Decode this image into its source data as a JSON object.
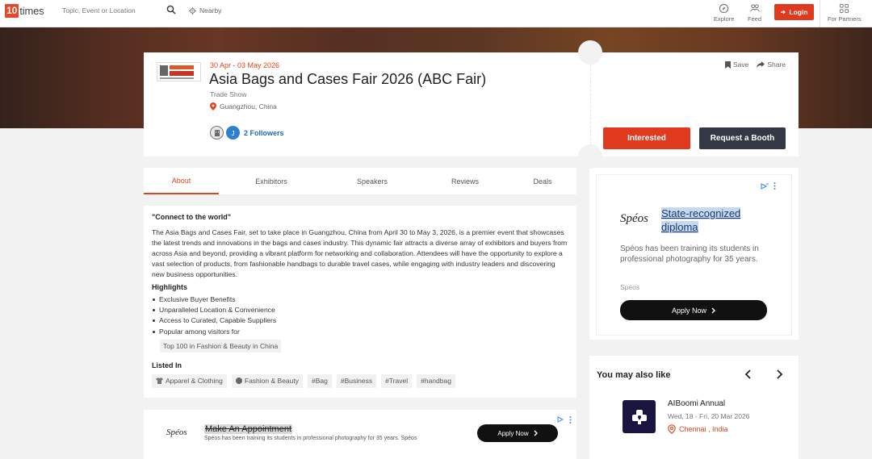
{
  "nav": {
    "logo_num": "10",
    "logo_text": "times",
    "search_placeholder": "Topic, Event or Location",
    "nearby": "Nearby",
    "explore": "Explore",
    "feed": "Feed",
    "login": "Login",
    "partners": "For Partners"
  },
  "event": {
    "date": "30 Apr - 03 May 2026",
    "title": "Asia Bags and Cases Fair 2026 (ABC Fair)",
    "type": "Trade Show",
    "location": "Guangzhou, China",
    "follower_avatar_2": "J",
    "followers": "2 Followers",
    "save": "Save",
    "share": "Share",
    "interested": "Interested",
    "request_booth": "Request a Booth"
  },
  "tabs": [
    "About",
    "Exhibitors",
    "Speakers",
    "Reviews",
    "Deals"
  ],
  "about": {
    "quote": "\"Connect to the world\"",
    "description": "The Asia Bags and Cases Fair, set to take place in Guangzhou, China from April 30 to May 3, 2026, is a premier event that showcases the latest trends and innovations in the bags and cases industry. This dynamic fair attracts a diverse array of exhibitors and buyers from across Asia and beyond, providing a vibrant platform for networking and collaboration. Attendees will have the opportunity to explore a vast selection of products, from fashionable handbags to durable travel cases, while engaging with industry leaders and discovering new business opportunities.",
    "highlights_heading": "Highlights",
    "highlights": [
      "Exclusive Buyer Benefits",
      "Unparalleled Location & Convenience",
      "Access to Curated, Capable Suppliers",
      "Popular among visitors for"
    ],
    "popular_tag": "Top 100 in Fashion & Beauty in China",
    "listed_heading": "Listed In",
    "listed_tags": [
      "Apparel & Clothing",
      "Fashion & Beauty",
      "#Bag",
      "#Business",
      "#Travel",
      "#handbag"
    ]
  },
  "bottom_ad": {
    "brand": "Spéos",
    "title": "Make An Appointment",
    "subtitle": "Spéos has been training its students in professional photography for 35 years. Spéos",
    "button": "Apply Now"
  },
  "right_ad": {
    "brand": "Spéos",
    "title": "State-recognized diploma",
    "description": "Spéos has been training its students in professional photography for 35 years.",
    "sponsor": "Spéos",
    "button": "Apply Now"
  },
  "also_like": {
    "heading": "You may also like",
    "event_name": "AIBoomi Annual",
    "event_dates": "Wed, 18 - Fri, 20 Mar 2026",
    "event_location": "Chennai , India"
  },
  "colors": {
    "accent": "#e03a1e",
    "dark_button": "#333844",
    "link_blue": "#1e6bb8"
  }
}
